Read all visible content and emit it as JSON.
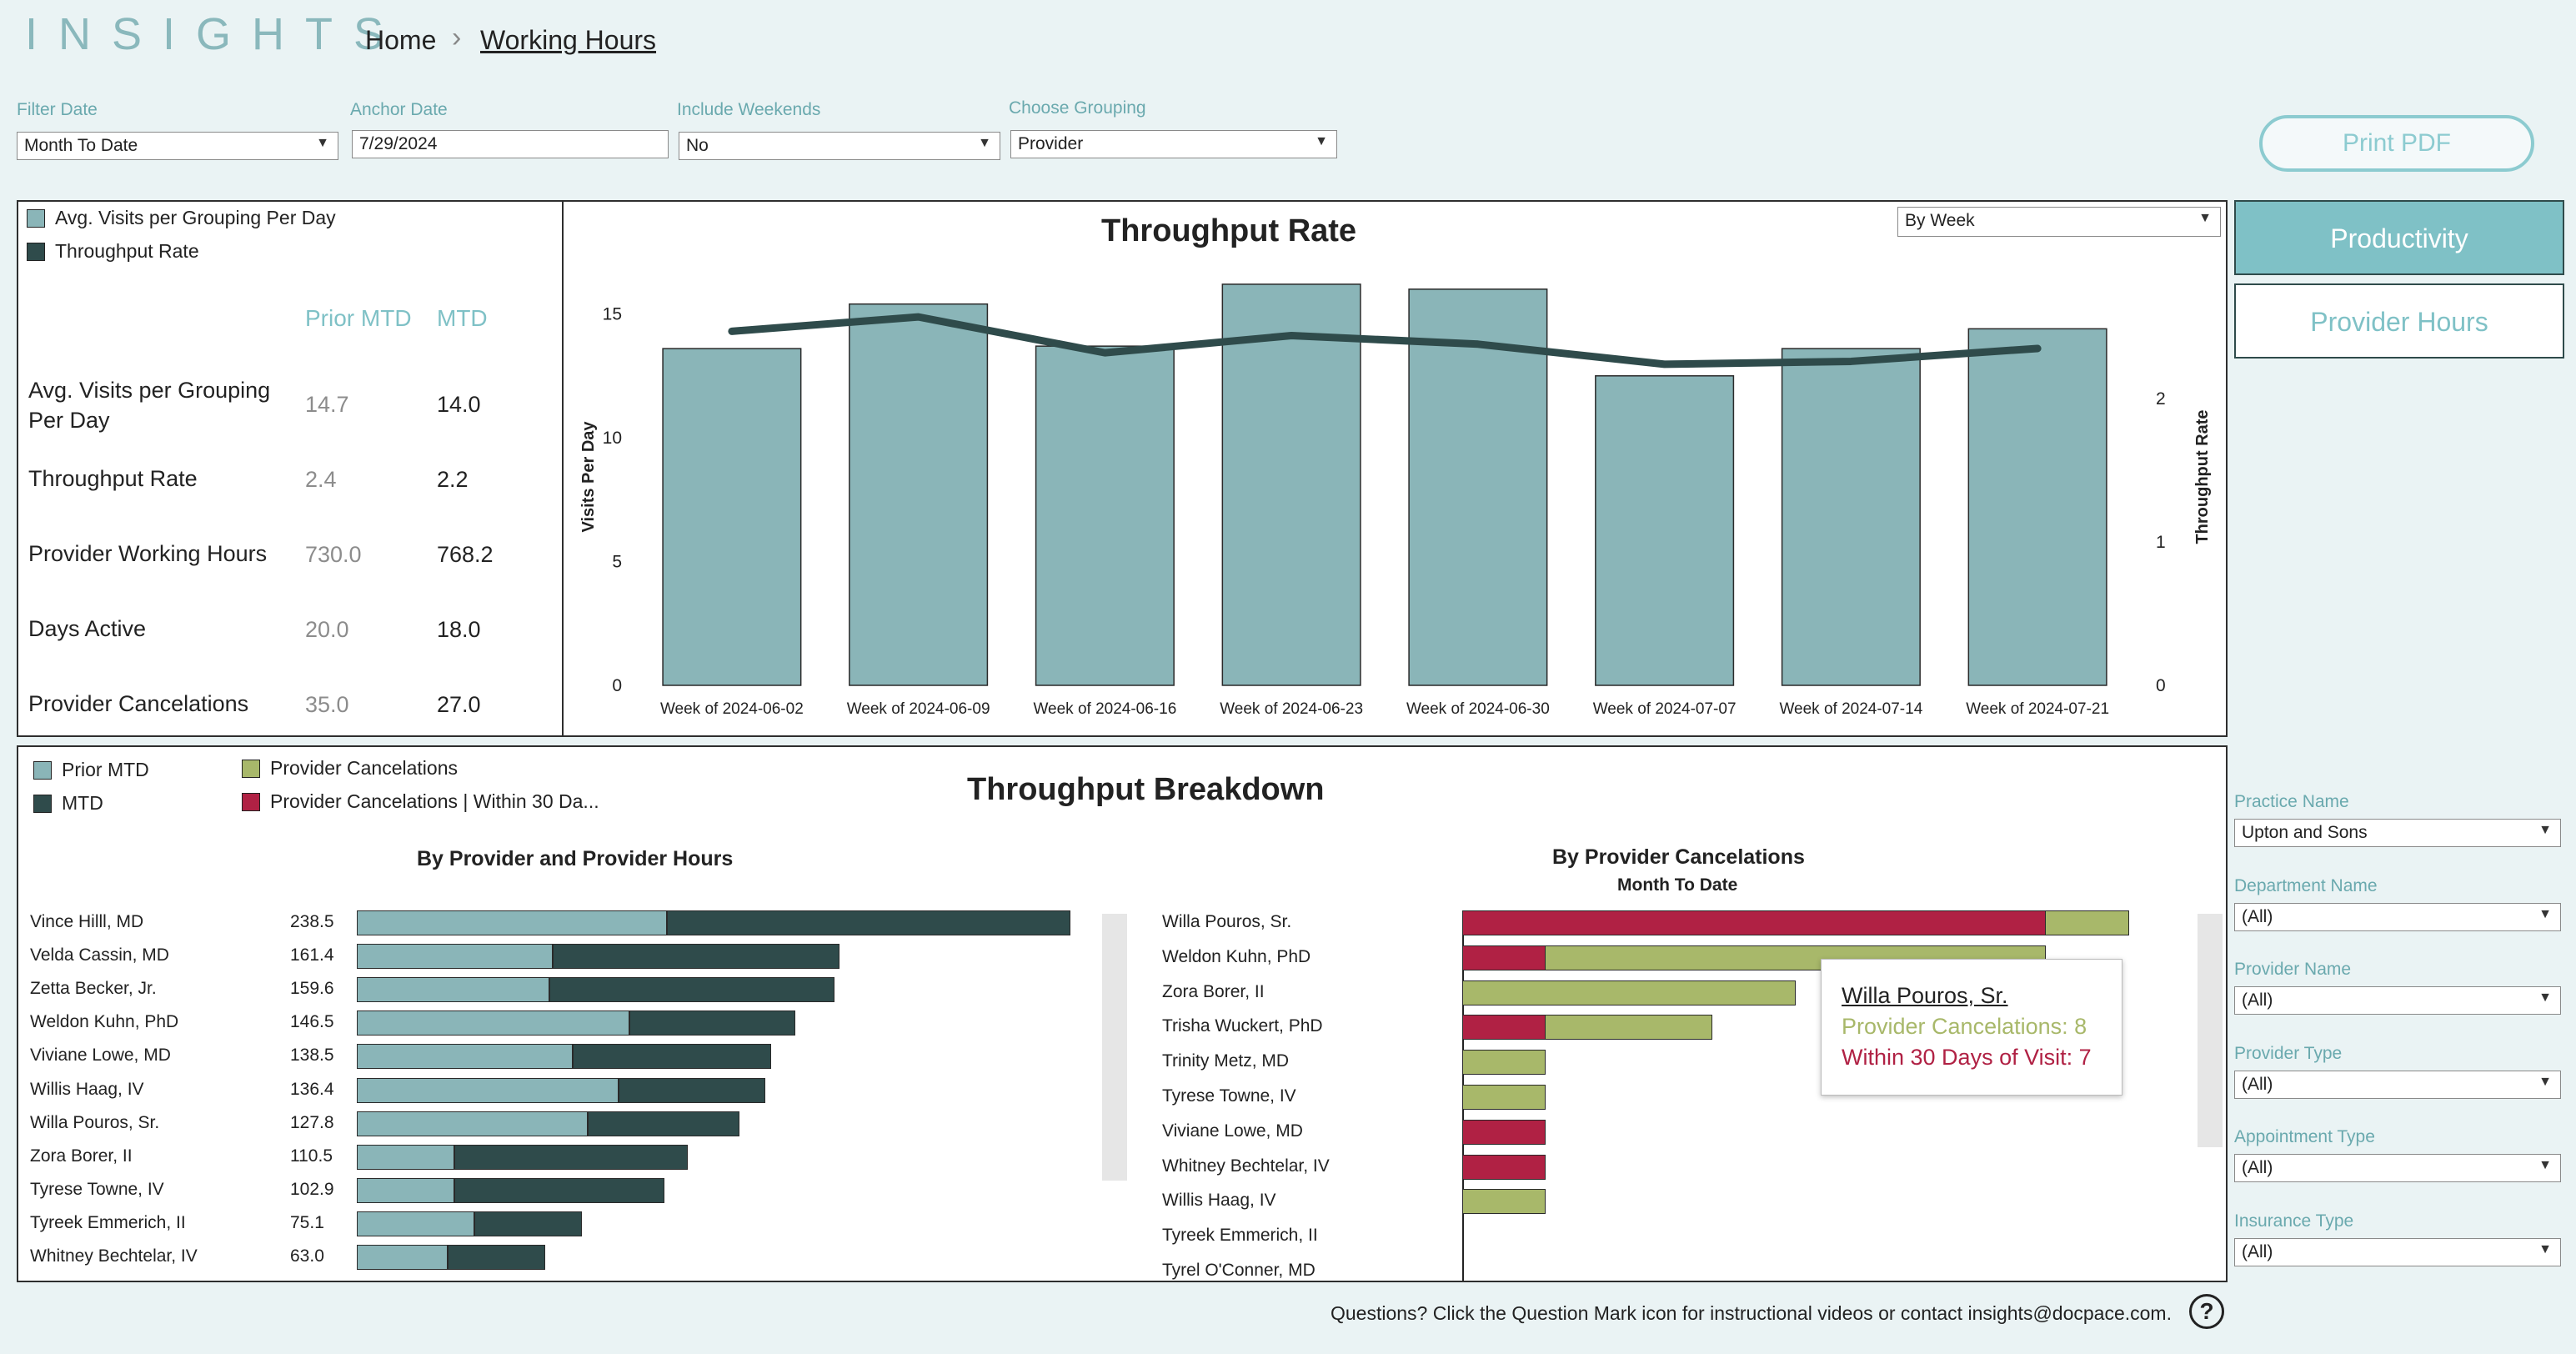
{
  "header": {
    "logo": "INSIGHTS",
    "breadcrumb_home": "Home",
    "breadcrumb_sep": "›",
    "breadcrumb_current": "Working Hours"
  },
  "filters": {
    "filter_date": {
      "label": "Filter Date",
      "value": "Month To Date"
    },
    "anchor_date": {
      "label": "Anchor Date",
      "value": "7/29/2024"
    },
    "include_weekends": {
      "label": "Include Weekends",
      "value": "No"
    },
    "choose_grouping": {
      "label": "Choose Grouping",
      "value": "Provider"
    }
  },
  "right_nav": {
    "print_pdf": "Print PDF",
    "tabs": [
      "Productivity",
      "Provider Hours"
    ],
    "active_tab": "Productivity"
  },
  "kpi": {
    "legend": [
      "Avg. Visits per Grouping Per Day",
      "Throughput Rate"
    ],
    "col_prior": "Prior MTD",
    "col_mtd": "MTD",
    "rows": [
      {
        "label": "Avg. Visits per Grouping Per Day",
        "prior": "14.7",
        "mtd": "14.0"
      },
      {
        "label": "Throughput Rate",
        "prior": "2.4",
        "mtd": "2.2"
      },
      {
        "label": "Provider Working Hours",
        "prior": "730.0",
        "mtd": "768.2"
      },
      {
        "label": "Days Active",
        "prior": "20.0",
        "mtd": "18.0"
      },
      {
        "label": "Provider Cancelations",
        "prior": "35.0",
        "mtd": "27.0"
      }
    ]
  },
  "throughput_chart": {
    "title": "Throughput Rate",
    "period_select": "By Week",
    "ylabel_left": "Visits Per Day",
    "ylabel_right": "Throughput Rate",
    "left_ticks": [
      "0",
      "5",
      "10",
      "15"
    ],
    "right_ticks": [
      "0",
      "1",
      "2"
    ]
  },
  "breakdown": {
    "title": "Throughput Breakdown",
    "legend": [
      "Prior MTD",
      "MTD",
      "Provider Cancelations",
      "Provider Cancelations | Within 30 Da..."
    ],
    "left_title": "By Provider and Provider Hours",
    "right_title": "By Provider Cancelations",
    "right_subtitle": "Month To Date"
  },
  "tooltip": {
    "name": "Willa Pouros, Sr.",
    "line1": "Provider Cancelations: 8",
    "line2": "Within 30 Days of Visit: 7"
  },
  "side_filters": [
    {
      "label": "Practice Name",
      "value": "Upton and Sons"
    },
    {
      "label": "Department Name",
      "value": "(All)"
    },
    {
      "label": "Provider Name",
      "value": "(All)"
    },
    {
      "label": "Provider Type",
      "value": "(All)"
    },
    {
      "label": "Appointment Type",
      "value": "(All)"
    },
    {
      "label": "Insurance Type",
      "value": "(All)"
    }
  ],
  "footer": {
    "text": "Questions? Click the Question Mark icon for instructional videos or contact insights@docpace.com.",
    "help": "?"
  },
  "colors": {
    "accent": "#7fc1c6",
    "bar_light": "#8ab5b8",
    "bar_dark": "#2f4b4b",
    "cancel_green": "#a8b86a",
    "cancel_red": "#b02144"
  },
  "chart_data": [
    {
      "type": "bar",
      "title": "Throughput Rate",
      "categories": [
        "Week of 2024-06-02",
        "Week of 2024-06-09",
        "Week of 2024-06-16",
        "Week of 2024-06-23",
        "Week of 2024-06-30",
        "Week of 2024-07-07",
        "Week of 2024-07-14",
        "Week of 2024-07-21"
      ],
      "series": [
        {
          "name": "Avg. Visits per Grouping Per Day",
          "type": "bar",
          "axis": "left",
          "values": [
            13.6,
            15.4,
            13.7,
            16.2,
            16.0,
            12.5,
            13.6,
            14.4
          ]
        },
        {
          "name": "Throughput Rate",
          "type": "line",
          "axis": "right",
          "values": [
            2.47,
            2.57,
            2.32,
            2.44,
            2.38,
            2.24,
            2.26,
            2.35
          ]
        }
      ],
      "ylabel": "Visits Per Day",
      "ylim": [
        0,
        16.5
      ],
      "y2label": "Throughput Rate",
      "y2lim": [
        0,
        2.85
      ]
    },
    {
      "type": "bar",
      "title": "By Provider and Provider Hours",
      "stacked": true,
      "categories": [
        "Vince Hilll, MD",
        "Velda Cassin, MD",
        "Zetta Becker, Jr.",
        "Weldon Kuhn, PhD",
        "Viviane Lowe, MD",
        "Willis Haag, IV",
        "Willa Pouros, Sr.",
        "Zora Borer, II",
        "Tyrese Towne, IV",
        "Tyreek Emmerich, II",
        "Whitney Bechtelar, IV"
      ],
      "labels": [
        "238.5",
        "161.4",
        "159.6",
        "146.5",
        "138.5",
        "136.4",
        "127.8",
        "110.5",
        "102.9",
        "75.1",
        "63.0"
      ],
      "series": [
        {
          "name": "Prior MTD",
          "values": [
            103.6,
            65.4,
            64.5,
            91.1,
            72.2,
            87.5,
            77.3,
            32.7,
            32.7,
            39.2,
            30.5
          ]
        },
        {
          "name": "MTD",
          "values": [
            134.9,
            96.0,
            95.1,
            55.4,
            66.3,
            48.9,
            50.5,
            77.8,
            70.2,
            35.9,
            32.5
          ]
        }
      ]
    },
    {
      "type": "bar",
      "title": "By Provider Cancelations",
      "subtitle": "Month To Date",
      "categories": [
        "Willa Pouros, Sr.",
        "Weldon Kuhn, PhD",
        "Zora Borer, II",
        "Trisha Wuckert, PhD",
        "Trinity Metz, MD",
        "Tyrese Towne, IV",
        "Viviane Lowe, MD",
        "Whitney Bechtelar, IV",
        "Willis Haag, IV",
        "Tyreek Emmerich, II",
        "Tyrel O'Conner, MD"
      ],
      "series": [
        {
          "name": "Provider Cancelations",
          "values": [
            8,
            7,
            4,
            3,
            1,
            1,
            1,
            1,
            1,
            0,
            0
          ]
        },
        {
          "name": "Provider Cancelations | Within 30 Da...",
          "values": [
            7,
            1,
            0,
            1,
            0,
            0,
            1,
            1,
            0,
            0,
            0
          ]
        }
      ]
    }
  ]
}
